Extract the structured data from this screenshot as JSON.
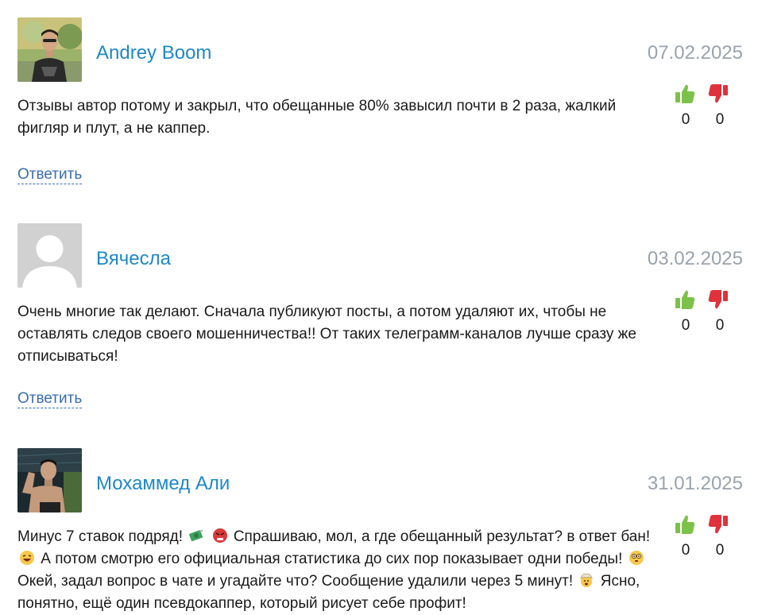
{
  "comments": [
    {
      "author": "Andrey Boom",
      "date": "07.02.2025",
      "text": "Отзывы автор потому и закрыл, что обещанные 80% завысил почти в 2 раза, жалкий фигляр и плут, а не каппер.",
      "likes": "0",
      "dislikes": "0",
      "reply_label": "Ответить"
    },
    {
      "author": "Вячесла",
      "date": "03.02.2025",
      "text": "Очень многие так делают. Сначала публикуют посты, а потом удаляют их, чтобы не оставлять следов своего мошенничества!! От таких телеграмм-каналов лучше сразу же отписываться!",
      "likes": "0",
      "dislikes": "0",
      "reply_label": "Ответить"
    },
    {
      "author": "Мохаммед Али",
      "date": "31.01.2025",
      "text_parts": [
        "Минус 7 ставок подряд!",
        "Спрашиваю, мол, а где обещанный результат? в ответ бан!",
        "А потом смотрю его официальная статистика до сих пор показывает одни победы!",
        "Окей, задал вопрос в чате и угадайте что? Сообщение удалили через 5 минут!",
        "Ясно, понятно, ещё один псевдокаппер, который рисует себе профит!"
      ],
      "likes": "0",
      "dislikes": "0"
    }
  ],
  "icons": {
    "like": "thumbs-up-icon",
    "dislike": "thumbs-down-icon"
  },
  "colors": {
    "author": "#1e88c8",
    "date": "#9aa3ad",
    "like": "#7cc24a",
    "dislike": "#e0323c",
    "reply": "#3a6db0"
  }
}
